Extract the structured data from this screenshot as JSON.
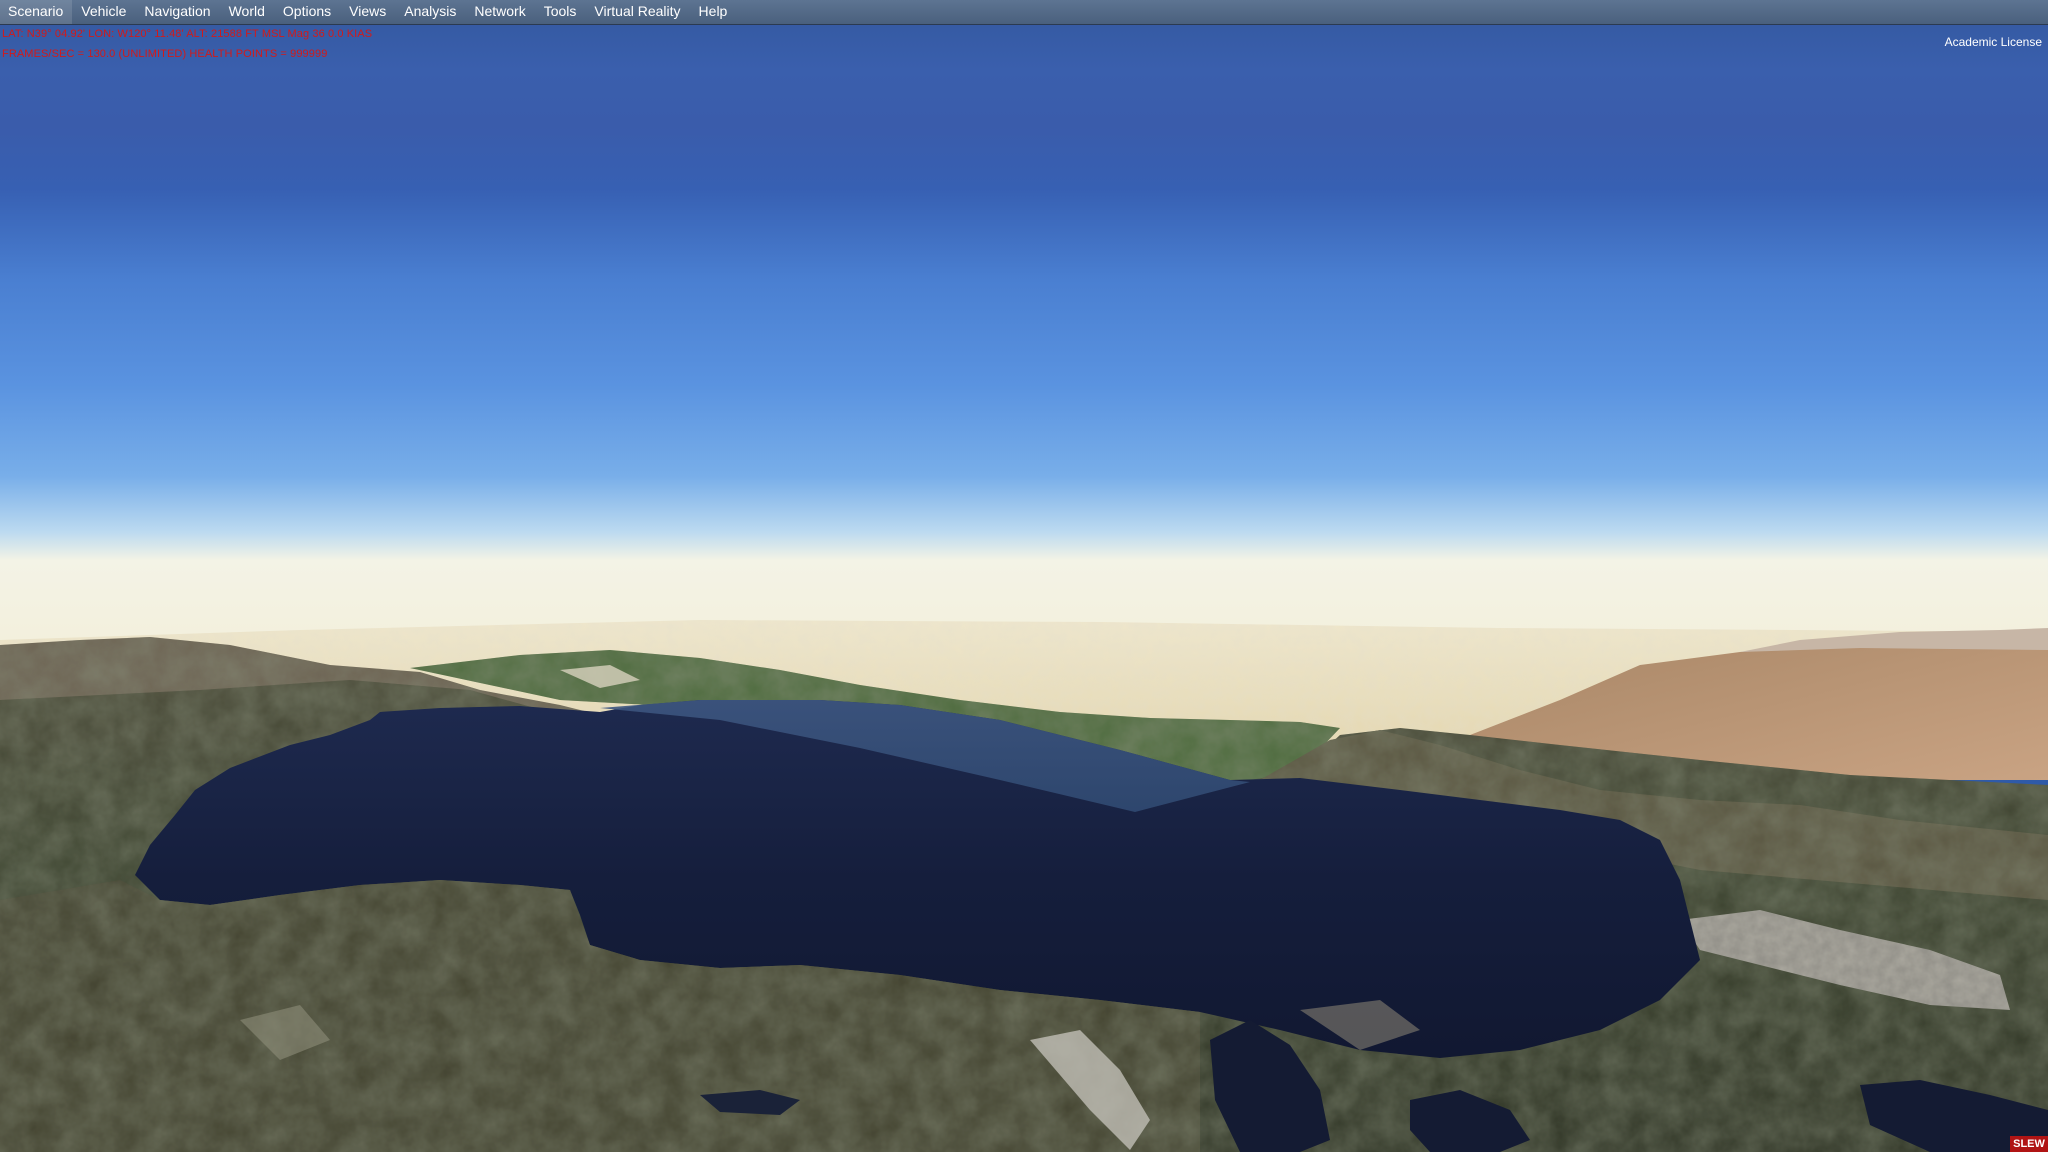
{
  "menu": {
    "items": [
      {
        "label": "Scenario",
        "name": "menu-scenario"
      },
      {
        "label": "Vehicle",
        "name": "menu-vehicle"
      },
      {
        "label": "Navigation",
        "name": "menu-navigation"
      },
      {
        "label": "World",
        "name": "menu-world"
      },
      {
        "label": "Options",
        "name": "menu-options"
      },
      {
        "label": "Views",
        "name": "menu-views"
      },
      {
        "label": "Analysis",
        "name": "menu-analysis"
      },
      {
        "label": "Network",
        "name": "menu-network"
      },
      {
        "label": "Tools",
        "name": "menu-tools"
      },
      {
        "label": "Virtual Reality",
        "name": "menu-virtual-reality"
      },
      {
        "label": "Help",
        "name": "menu-help"
      }
    ]
  },
  "hud": {
    "line1": "LAT: N39° 04.92'  LON: W120° 11.48'  ALT: 21588 FT  MSL   Mag 36  0.0 KIAS",
    "line2": "FRAMES/SEC = 130.0   (UNLIMITED)   HEALTH POINTS = 999999"
  },
  "license": {
    "text": "Academic License"
  },
  "status": {
    "slew": "SLEW"
  },
  "colors": {
    "hud_text": "#d21a1a",
    "menubar": "#4f6583",
    "sky_top": "#2f55a3",
    "sky_horizon": "#f5f2dc",
    "lake": "#141d3a",
    "slew_badge": "#b01414"
  }
}
